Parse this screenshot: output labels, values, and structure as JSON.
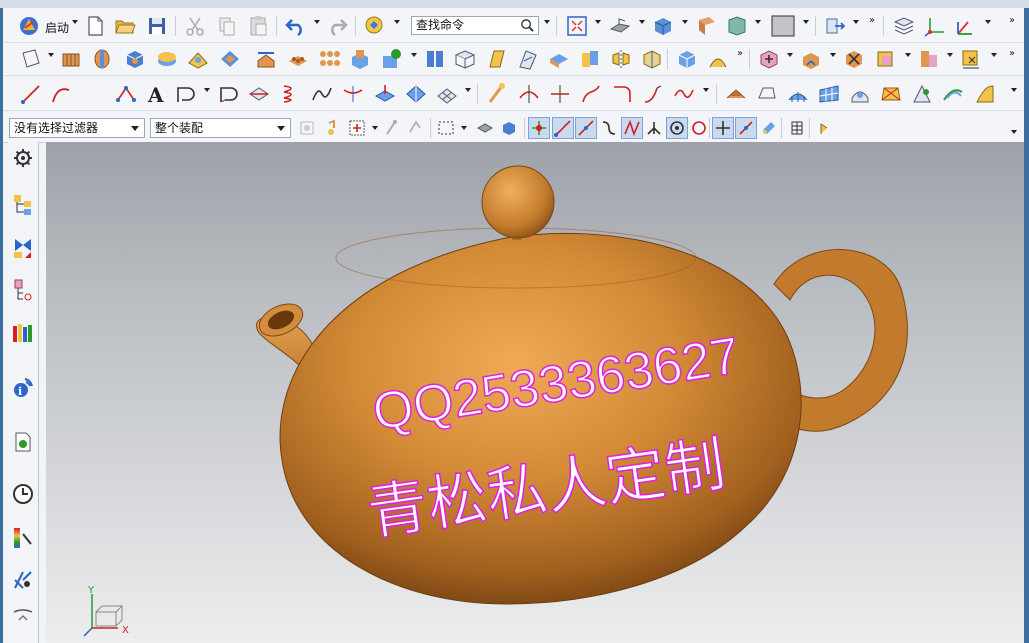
{
  "toolbar": {
    "start_label": "启动",
    "search_text": "查找命令"
  },
  "selection_bar": {
    "filter_value": "没有选择过滤器",
    "scope_value": "整个装配"
  },
  "viewport": {
    "model": "teapot",
    "body_color": "#c98230",
    "mark_color": "#e21ee6",
    "engraving_line1": "QQ2533363627",
    "engraving_line2": "青松私人定制",
    "triad_x_label": "X",
    "triad_y_label": "Y"
  },
  "resource_bar": {
    "items": [
      "settings-icon",
      "assembly-navigator-icon",
      "constraint-navigator-icon",
      "part-navigator-icon",
      "reuse-library-icon",
      "hd3d-tools-icon",
      "web-browser-icon",
      "history-icon",
      "visualization-icon",
      "roles-icon"
    ]
  }
}
